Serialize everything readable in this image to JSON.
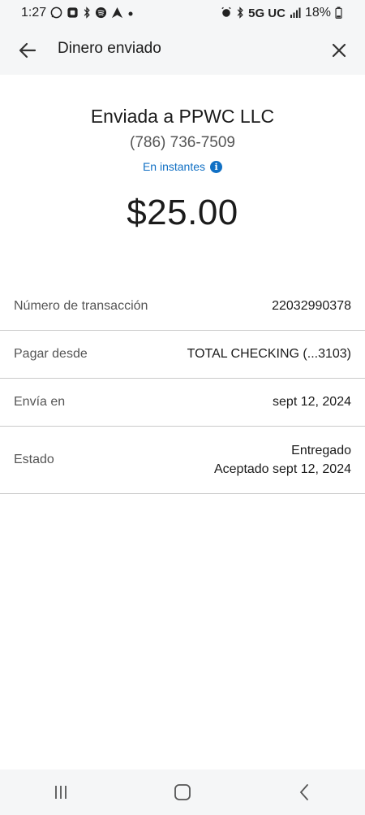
{
  "status_bar": {
    "time": "1:27",
    "network": "5G UC",
    "battery": "18%",
    "left_icons": [
      "whatsapp-icon",
      "chat-icon",
      "bluetooth-icon",
      "spotify-icon",
      "nav-arrow-icon"
    ],
    "right_icons": [
      "alarm-icon",
      "bluetooth-icon",
      "signal-icon",
      "battery-icon"
    ]
  },
  "header": {
    "title": "Dinero enviado"
  },
  "summary": {
    "sent_prefix": "Enviada a",
    "recipient": "PPWC LLC",
    "phone": "(786) 736-7509",
    "speed": "En instantes",
    "amount": "$25.00"
  },
  "details": [
    {
      "label": "Número de transacción",
      "value": "22032990378"
    },
    {
      "label": "Pagar desde",
      "value": "TOTAL CHECKING (...3103)"
    },
    {
      "label": "Envía en",
      "value": "sept 12, 2024"
    },
    {
      "label": "Estado",
      "value_line1": "Entregado",
      "value_line2": "Aceptado sept 12, 2024"
    }
  ],
  "colors": {
    "accent": "#1170c4",
    "header_bg": "#f5f6f7",
    "divider": "#c9c9c9"
  }
}
